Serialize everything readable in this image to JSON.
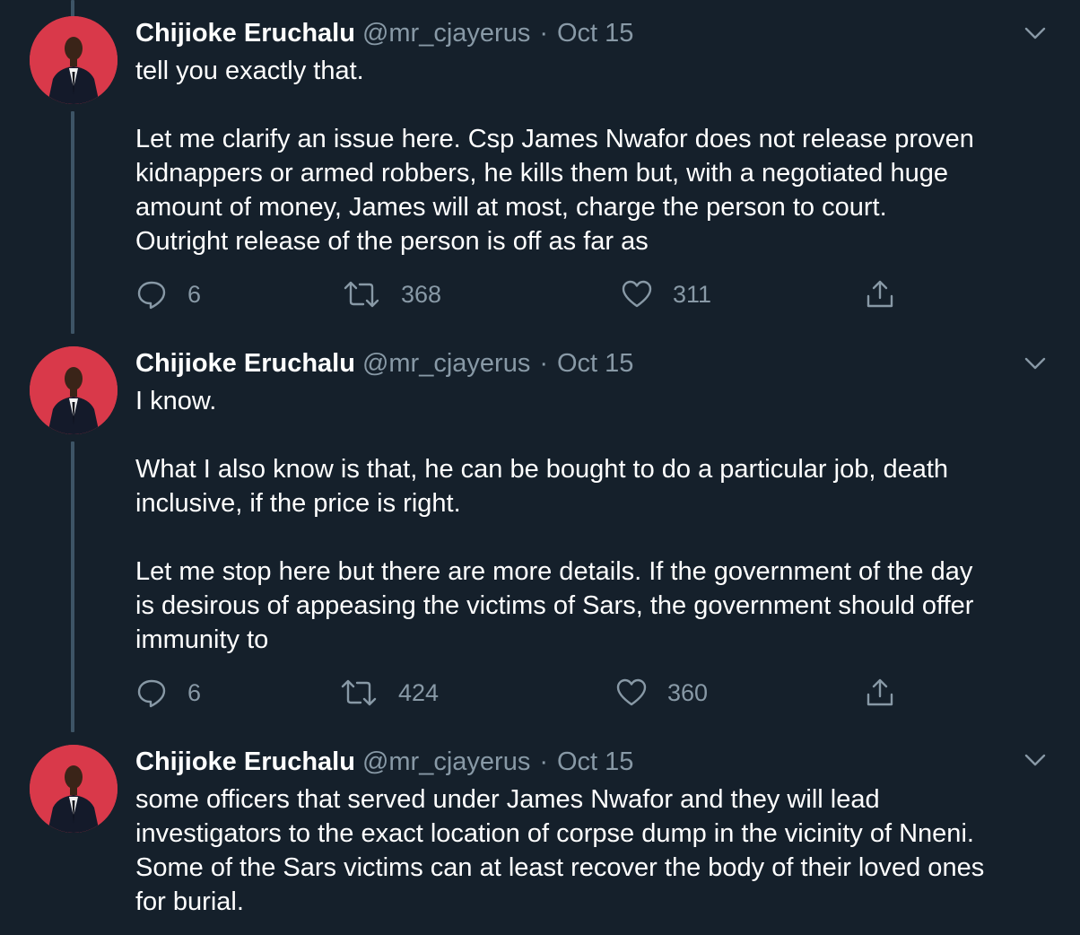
{
  "tweets": [
    {
      "author_name": "Chijioke Eruchalu",
      "handle": "@mr_cjayerus",
      "separator": "·",
      "date": "Oct 15",
      "paragraphs": [
        "tell you exactly that.",
        "Let me clarify an issue here. Csp James Nwafor does not release proven\nkidnappers or armed robbers, he kills them but, with a negotiated huge\namount of money, James will at most, charge the person to court.\nOutright release of the person is off as far as"
      ],
      "replies": "6",
      "retweets": "368",
      "likes": "311"
    },
    {
      "author_name": "Chijioke Eruchalu",
      "handle": "@mr_cjayerus",
      "separator": "·",
      "date": "Oct 15",
      "paragraphs": [
        "I know.",
        "What I also know is that, he can be bought to do a particular job, death\ninclusive, if the price is right.",
        "Let me stop here but there are more details. If the government of the day\nis desirous of appeasing the victims of Sars, the government should offer\nimmunity to"
      ],
      "replies": "6",
      "retweets": "424",
      "likes": "360"
    },
    {
      "author_name": "Chijioke Eruchalu",
      "handle": "@mr_cjayerus",
      "separator": "·",
      "date": "Oct 15",
      "paragraphs": [
        "some officers that served under James Nwafor and they will lead\ninvestigators to the exact location of corpse dump in the vicinity of Nneni.\nSome of the Sars victims can at least recover the body of their loved ones\nfor burial."
      ]
    }
  ],
  "icons": {
    "reply": "reply-icon",
    "retweet": "retweet-icon",
    "like": "heart-icon",
    "share": "share-icon",
    "more": "chevron-down-icon"
  },
  "colors": {
    "background": "#15202b",
    "text": "#ffffff",
    "secondary": "#8899a6",
    "thread_line": "#3d5466",
    "avatar_bg": "#d9394a"
  }
}
